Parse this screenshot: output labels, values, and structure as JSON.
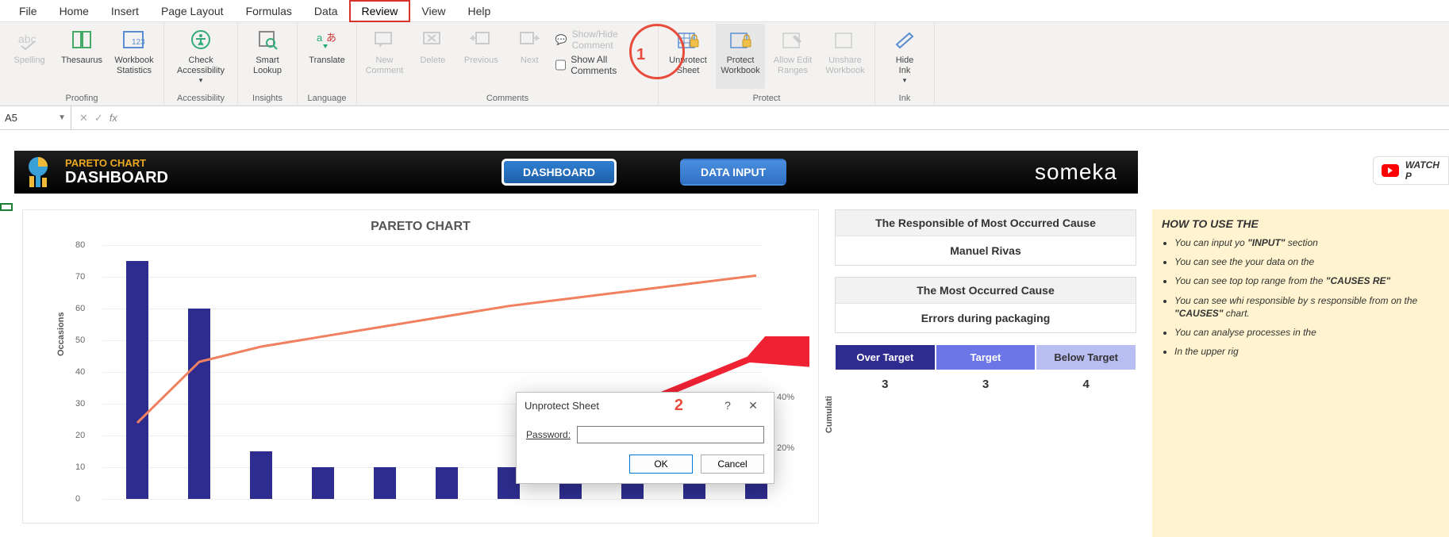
{
  "ribbon": {
    "tabs": [
      "File",
      "Home",
      "Insert",
      "Page Layout",
      "Formulas",
      "Data",
      "Review",
      "View",
      "Help"
    ],
    "active_tab": "Review",
    "groups": {
      "proofing": {
        "label": "Proofing",
        "spelling": "Spelling",
        "thesaurus": "Thesaurus",
        "stats": "Workbook\nStatistics"
      },
      "accessibility": {
        "label": "Accessibility",
        "check": "Check\nAccessibility"
      },
      "insights": {
        "label": "Insights",
        "smart": "Smart\nLookup"
      },
      "language": {
        "label": "Language",
        "translate": "Translate"
      },
      "comments": {
        "label": "Comments",
        "new": "New\nComment",
        "delete": "Delete",
        "prev": "Previous",
        "next": "Next",
        "showhide": "Show/Hide Comment",
        "showall": "Show All Comments"
      },
      "protect": {
        "label": "Protect",
        "unprotect": "Unprotect\nSheet",
        "workbook": "Protect\nWorkbook",
        "allow": "Allow Edit\nRanges",
        "unshare": "Unshare\nWorkbook"
      },
      "ink": {
        "label": "Ink",
        "hide": "Hide\nInk"
      }
    }
  },
  "annotations": {
    "circle_num": "1",
    "dialog_num": "2"
  },
  "formula_bar": {
    "cell": "A5",
    "fx": "fx"
  },
  "dashboard": {
    "subtitle": "PARETO CHART",
    "title": "DASHBOARD",
    "btn_dashboard": "DASHBOARD",
    "btn_datainput": "DATA INPUT",
    "brand": "someka",
    "watch": "WATCH P"
  },
  "chart_data": {
    "type": "bar",
    "title": "PARETO CHART",
    "xlabel": "",
    "ylabel": "Occasions",
    "y2label": "Cumulati",
    "ylim": [
      0,
      80
    ],
    "y_ticks": [
      0,
      10,
      20,
      30,
      40,
      50,
      60,
      70,
      80
    ],
    "y2_ticks": [
      "20%",
      "40%"
    ],
    "values": [
      75,
      60,
      15,
      10,
      10,
      10,
      10,
      8,
      8,
      7,
      7
    ],
    "cumulative_pct": [
      30,
      54,
      60,
      64,
      68,
      72,
      76,
      79,
      82,
      85,
      88
    ]
  },
  "side": {
    "resp_title": "The Responsible of Most Occurred Cause",
    "resp_value": "Manuel Rivas",
    "cause_title": "The Most Occurred Cause",
    "cause_value": "Errors during packaging",
    "over": "Over Target",
    "target": "Target",
    "below": "Below Target",
    "over_v": "3",
    "target_v": "3",
    "below_v": "4"
  },
  "help": {
    "title": "HOW TO USE THE",
    "items": [
      "You can input yo <b>\"INPUT\"</b> section",
      "You can see the your data on the",
      "You can see top top range from the <b>\"CAUSES RE\"</b>",
      "You can see whi responsible by s responsible from on the <b>\"CAUSES\"</b> chart.",
      "You can analyse processes in the",
      "In the upper rig"
    ]
  },
  "dialog": {
    "title": "Unprotect Sheet",
    "password_label": "Password:",
    "ok": "OK",
    "cancel": "Cancel",
    "help": "?",
    "close": "✕"
  }
}
